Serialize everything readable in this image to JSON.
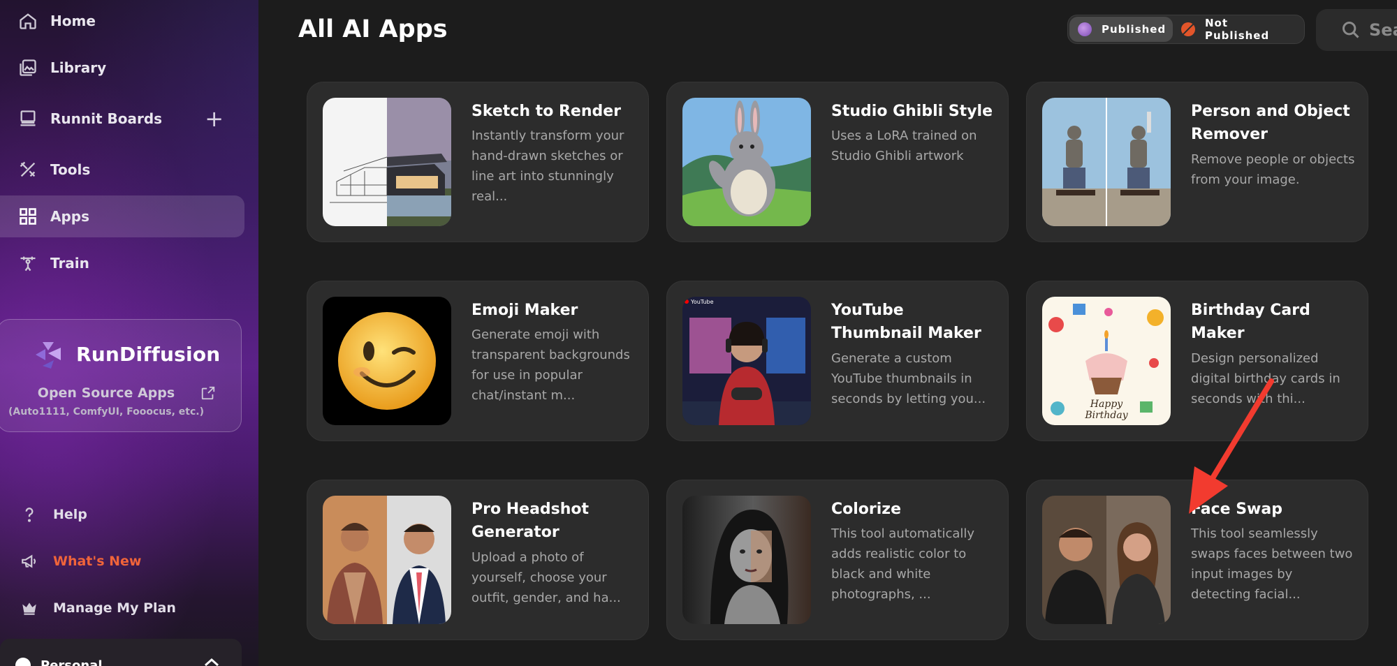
{
  "sidebar": {
    "nav": [
      {
        "label": "Home",
        "icon": "home-icon"
      },
      {
        "label": "Library",
        "icon": "library-icon"
      },
      {
        "label": "Runnit Boards",
        "icon": "boards-icon"
      },
      {
        "label": "Tools",
        "icon": "tools-icon"
      },
      {
        "label": "Apps",
        "icon": "apps-icon",
        "active": true
      },
      {
        "label": "Train",
        "icon": "train-icon"
      }
    ],
    "add_label": "+",
    "promo": {
      "brand": "RunDiffusion",
      "link_label": "Open Source Apps",
      "sub": "(Auto1111, ComfyUI, Fooocus, etc.)"
    },
    "bottom": [
      {
        "label": "Help",
        "icon": "help-icon"
      },
      {
        "label": "What's New",
        "icon": "megaphone-icon"
      },
      {
        "label": "Manage My Plan",
        "icon": "crown-icon"
      }
    ],
    "account_label": "Personal"
  },
  "main": {
    "title": "All AI Apps",
    "toggle": {
      "published": "Published",
      "not_published": "Not Published"
    },
    "search_placeholder": "Sea"
  },
  "apps": [
    {
      "title": "Sketch to Render",
      "desc": "Instantly transform your hand-drawn sketches or line art into stunningly real..."
    },
    {
      "title": "Studio Ghibli Style",
      "desc": "Uses a LoRA trained on Studio Ghibli artwork"
    },
    {
      "title": "Person and Object Remover",
      "desc": "Remove people or objects from your image."
    },
    {
      "title": "Emoji Maker",
      "desc": "Generate emoji with transparent backgrounds for use in popular chat/instant m..."
    },
    {
      "title": "YouTube Thumbnail Maker",
      "desc": "Generate a custom YouTube thumbnails in seconds by letting you..."
    },
    {
      "title": "Birthday Card Maker",
      "desc": "Design personalized digital birthday cards in seconds with thi..."
    },
    {
      "title": "Pro Headshot Generator",
      "desc": "Upload a photo of yourself, choose your outfit, gender, and ha..."
    },
    {
      "title": "Colorize",
      "desc": "This tool automatically adds realistic color to black and white photographs, ..."
    },
    {
      "title": "Face Swap",
      "desc": "This tool seamlessly swaps faces between two input images by detecting facial..."
    }
  ],
  "thumb_text": {
    "youtube": "YouTube",
    "birthday_line1": "Happy",
    "birthday_line2": "Birthday"
  },
  "colors": {
    "accent_orange": "#f0643a",
    "arrow_red": "#f23b2f",
    "card_bg": "#2c2c2c"
  }
}
